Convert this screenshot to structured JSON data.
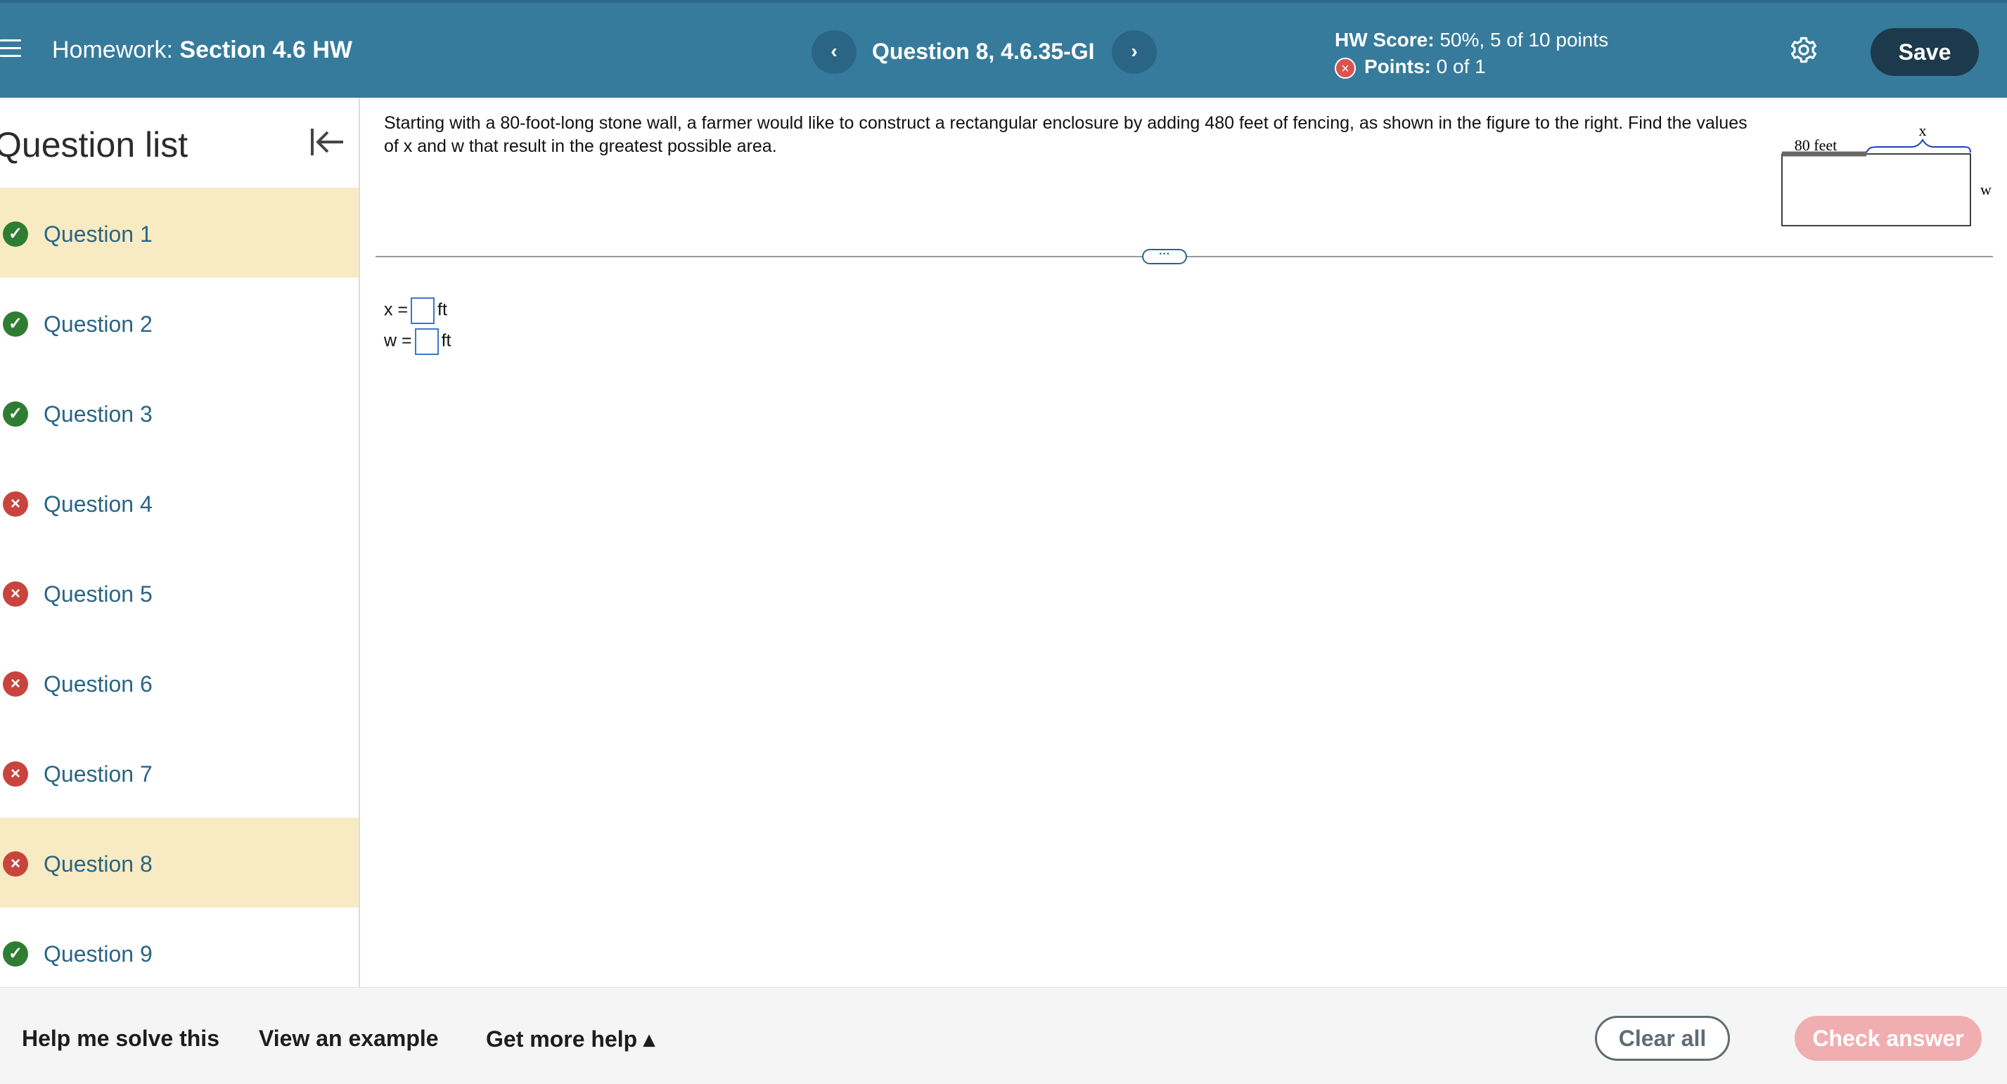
{
  "header": {
    "hw_prefix": "Homework:",
    "hw_section": "Section 4.6 HW",
    "question_title": "Question 8, 4.6.35-GI",
    "score_label": "HW Score:",
    "score_value": "50%, 5 of 10 points",
    "points_label": "Points:",
    "points_value": "0 of 1",
    "save_label": "Save",
    "prev_icon": "chevron-left-icon",
    "next_icon": "chevron-right-icon"
  },
  "sidebar": {
    "title": "Question list",
    "items": [
      {
        "label": "Question 1",
        "status": "correct",
        "highlight": true
      },
      {
        "label": "Question 2",
        "status": "correct",
        "highlight": false
      },
      {
        "label": "Question 3",
        "status": "correct",
        "highlight": false
      },
      {
        "label": "Question 4",
        "status": "incorrect",
        "highlight": false
      },
      {
        "label": "Question 5",
        "status": "incorrect",
        "highlight": false
      },
      {
        "label": "Question 6",
        "status": "incorrect",
        "highlight": false
      },
      {
        "label": "Question 7",
        "status": "incorrect",
        "highlight": false
      },
      {
        "label": "Question 8",
        "status": "incorrect",
        "highlight": true
      },
      {
        "label": "Question 9",
        "status": "correct",
        "highlight": false
      }
    ]
  },
  "question": {
    "prompt": "Starting with a 80-foot-long stone wall, a farmer would like to construct a rectangular enclosure by adding 480 feet of fencing, as shown in the figure to the right. Find the values of x and w that result in the greatest possible area.",
    "figure": {
      "wall_label": "80 feet",
      "x_label": "x",
      "w_label": "w"
    },
    "answers": [
      {
        "var": "x =",
        "unit": "ft",
        "value": ""
      },
      {
        "var": "w =",
        "unit": "ft",
        "value": ""
      }
    ]
  },
  "footer": {
    "help_label": "Help me solve this",
    "example_label": "View an example",
    "more_help_label": "Get more help ▴",
    "clear_label": "Clear all",
    "check_label": "Check answer"
  },
  "colors": {
    "header_bg": "#367b9c",
    "highlight_bg": "#f8ebc3",
    "correct": "#2f7d32",
    "incorrect": "#c9443d",
    "link": "#2a6585",
    "check_disabled": "#f1aeb1"
  }
}
